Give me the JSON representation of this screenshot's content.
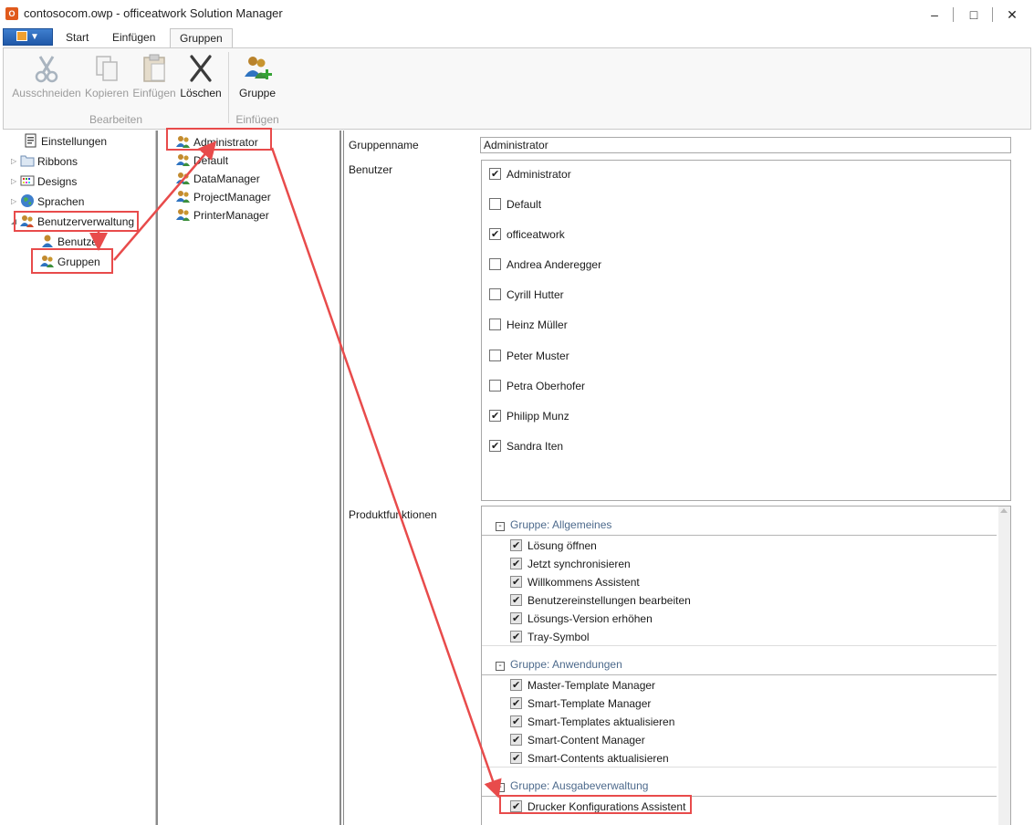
{
  "window": {
    "title": "contosocom.owp - officeatwork Solution Manager",
    "app_icon": "O",
    "minimize": "–",
    "maximize": "□",
    "close": "✕"
  },
  "tabs": {
    "app_menu": "▼",
    "start": "Start",
    "einfuegen": "Einfügen",
    "gruppen": "Gruppen"
  },
  "ribbon": {
    "ausschneiden": "Ausschneiden",
    "kopieren": "Kopieren",
    "einfuegen": "Einfügen",
    "loeschen": "Löschen",
    "gruppe": "Gruppe",
    "group_bearbeiten": "Bearbeiten",
    "group_einfuegen": "Einfügen"
  },
  "nav": {
    "einstellungen": "Einstellungen",
    "ribbons": "Ribbons",
    "designs": "Designs",
    "sprachen": "Sprachen",
    "benutzerverwaltung": "Benutzerverwaltung",
    "benutzer": "Benutzer",
    "gruppen": "Gruppen"
  },
  "groups": [
    "Administrator",
    "Default",
    "DataManager",
    "ProjectManager",
    "PrinterManager"
  ],
  "detail": {
    "gruppenname_label": "Gruppenname",
    "gruppenname_value": "Administrator",
    "benutzer_label": "Benutzer",
    "produktfunktionen_label": "Produktfunktionen"
  },
  "users": [
    {
      "name": "Administrator",
      "checked": true
    },
    {
      "name": "Default",
      "checked": false
    },
    {
      "name": "officeatwork",
      "checked": true
    },
    {
      "name": "Andrea Anderegger",
      "checked": false
    },
    {
      "name": "Cyrill Hutter",
      "checked": false
    },
    {
      "name": "Heinz Müller",
      "checked": false
    },
    {
      "name": "Peter Muster",
      "checked": false
    },
    {
      "name": "Petra Oberhofer",
      "checked": false
    },
    {
      "name": "Philipp Munz",
      "checked": true
    },
    {
      "name": "Sandra Iten",
      "checked": true
    }
  ],
  "feature_groups": [
    {
      "title": "Gruppe: Allgemeines",
      "items": [
        "Lösung öffnen",
        "Jetzt synchronisieren",
        "Willkommens Assistent",
        "Benutzereinstellungen bearbeiten",
        "Lösungs-Version erhöhen",
        "Tray-Symbol"
      ]
    },
    {
      "title": "Gruppe: Anwendungen",
      "items": [
        "Master-Template Manager",
        "Smart-Template Manager",
        "Smart-Templates aktualisieren",
        "Smart-Content Manager",
        "Smart-Contents aktualisieren"
      ]
    },
    {
      "title": "Gruppe: Ausgabeverwaltung",
      "items": [
        "Drucker Konfigurations Assistent"
      ]
    }
  ],
  "colors": {
    "annotation": "#e84b4b",
    "group_header": "#4d6a8c"
  }
}
